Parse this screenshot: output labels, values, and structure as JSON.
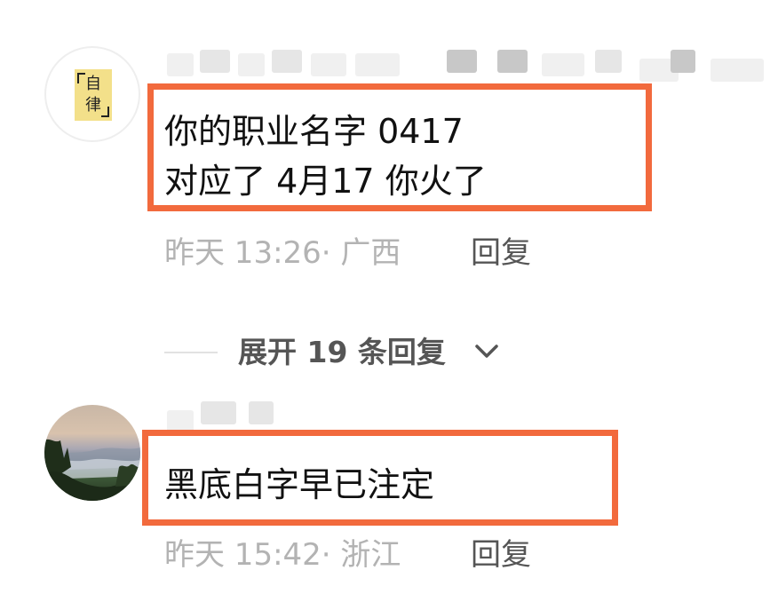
{
  "comments": [
    {
      "avatar": {
        "icon": "self-discipline-badge-icon",
        "badge_chars": [
          "自",
          "律"
        ]
      },
      "text_lines": [
        "你的职业名字 0417",
        "对应了 4月17 你火了"
      ],
      "time_location": "昨天 13:26· 广西",
      "reply_label": "回复"
    },
    {
      "avatar": {
        "icon": "landscape-photo-avatar"
      },
      "text_lines": [
        "黑底白字早已注定"
      ],
      "time_location": "昨天 15:42· 浙江",
      "reply_label": "回复"
    }
  ],
  "expand": {
    "label": "展开 19 条回复",
    "icon": "chevron-down-icon"
  },
  "colors": {
    "highlight_border": "#f26a3d",
    "meta_text": "#b3b3b3",
    "reply_text": "#555555",
    "body_text": "#111111"
  }
}
